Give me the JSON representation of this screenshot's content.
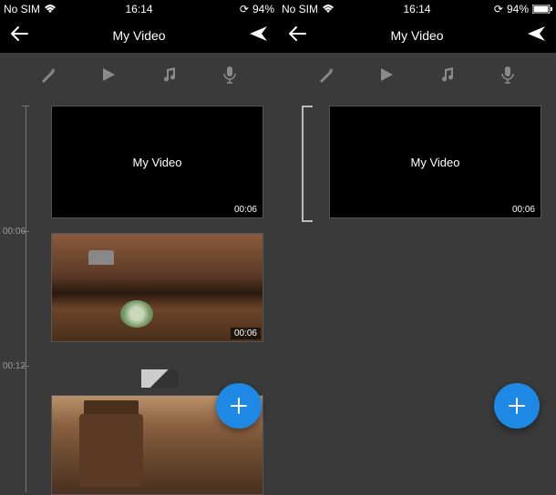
{
  "left": {
    "status": {
      "carrier": "No SIM",
      "time": "16:14",
      "battery": "94%"
    },
    "nav": {
      "title": "My Video"
    },
    "toolbar": {
      "magic": "✧",
      "play": "▶",
      "music": "♫",
      "mic": "🎤"
    },
    "timeline": {
      "labels": [
        "00:06",
        "00:12"
      ],
      "clip1": {
        "title": "My Video",
        "duration": "00:06"
      },
      "clip2": {
        "duration": "00:06"
      }
    },
    "fab": "+"
  },
  "right": {
    "status": {
      "carrier": "No SIM",
      "time": "16:14",
      "battery": "94%"
    },
    "nav": {
      "title": "My Video"
    },
    "toolbar": {
      "magic": "✧",
      "play": "▶",
      "music": "♫",
      "mic": "🎤"
    },
    "timeline": {
      "clip1": {
        "title": "My Video",
        "duration": "00:06"
      }
    },
    "fab": "+"
  }
}
